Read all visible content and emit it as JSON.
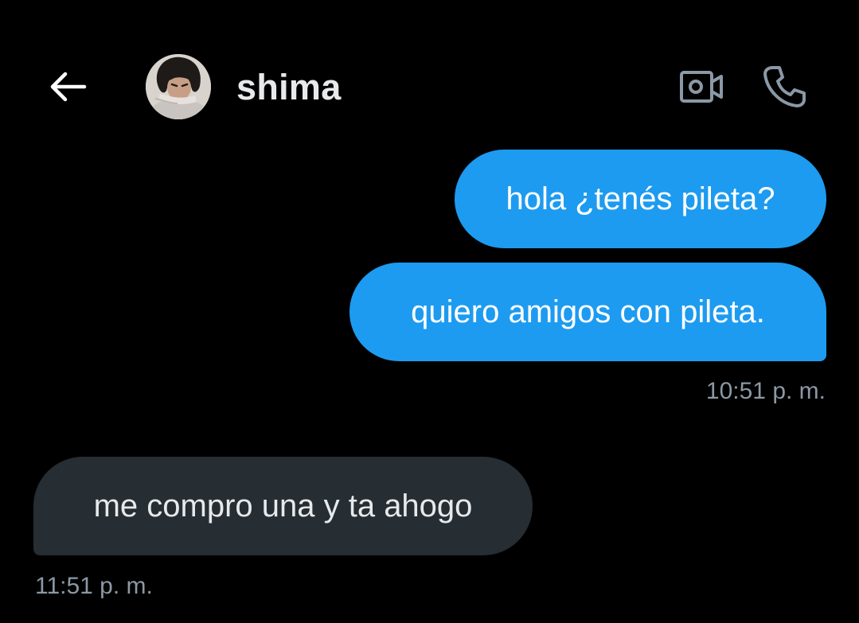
{
  "header": {
    "back_icon": "arrow-left-icon",
    "contact_name": "shima",
    "avatar_alt": "shima",
    "video_icon": "video-camera-icon",
    "phone_icon": "phone-icon"
  },
  "messages": [
    {
      "direction": "sent",
      "text": "hola ¿tenés pileta?"
    },
    {
      "direction": "sent",
      "text": "quiero amigos con pileta."
    },
    {
      "direction": "received",
      "text": "me compro una y ta ahogo"
    }
  ],
  "timestamps": {
    "sent_group": "10:51 p. m.",
    "received_group": "11:51 p. m."
  },
  "colors": {
    "background": "#000000",
    "sent_bubble": "#1d9bf0",
    "received_bubble": "#262d33",
    "primary_text": "#e7e9ea",
    "secondary_text": "#8b98a5"
  }
}
